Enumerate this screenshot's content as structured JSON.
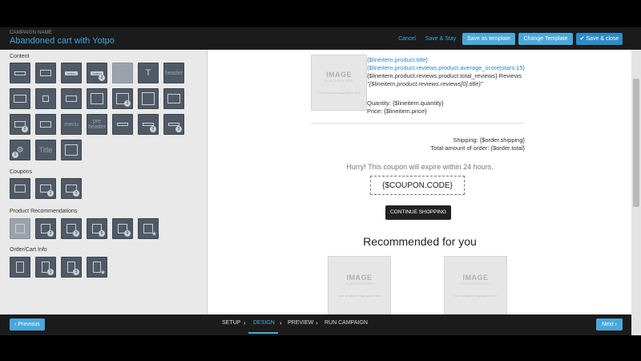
{
  "header": {
    "campaign_label": "CAMPAIGN NAME",
    "campaign_name": "Abandoned cart with Yotpo",
    "cancel": "Cancel",
    "save_stay": "Save & Stay",
    "save_template": "Save as template",
    "change_template": "Change Template",
    "save_close": "✔ Save & close"
  },
  "left": {
    "content_title": "Content",
    "coupons_title": "Coupons",
    "product_rec_title": "Product Recommendations",
    "order_title": "Order/Cart Info",
    "content_labels": {
      "button1": "button",
      "button2": "button",
      "footer": "footer",
      "text": "T",
      "header": "header",
      "menu": "menu",
      "pre_header": "pre header",
      "title": "Title"
    }
  },
  "email": {
    "image_placeholder": "IMAGE",
    "image_placeholder_sub": "PLACEHOLDER",
    "image_placeholder_hint": "Your product image goes here",
    "product_title": "{$lineitem.product.title}",
    "product_score": "{$lineitem.product.reviews.product.average_score|stars:15}",
    "product_reviews": "{$lineitem.product.reviews.product.total_reviews} Reviews",
    "review_title": "\"{$lineitem.product.reviews.reviews[0].title}\"",
    "quantity": "Quantity: {$lineitem.quantity}",
    "price": "Price: {$lineitem.price}",
    "shipping": "Shipping: {$order.shipping}",
    "total": "Total amount of order: {$order.total}",
    "hurry": "Hurry! This coupon will expire within 24 hours.",
    "coupon_code": "{$COUPON.CODE}",
    "continue_button": "CONTINUE SHOPPING",
    "recommended": "Recommended for you"
  },
  "footer": {
    "previous": "‹ Previous",
    "next": "Next ›",
    "steps": [
      "SETUP",
      "DESIGN",
      "PREVIEW",
      "RUN CAMPAIGN"
    ]
  }
}
